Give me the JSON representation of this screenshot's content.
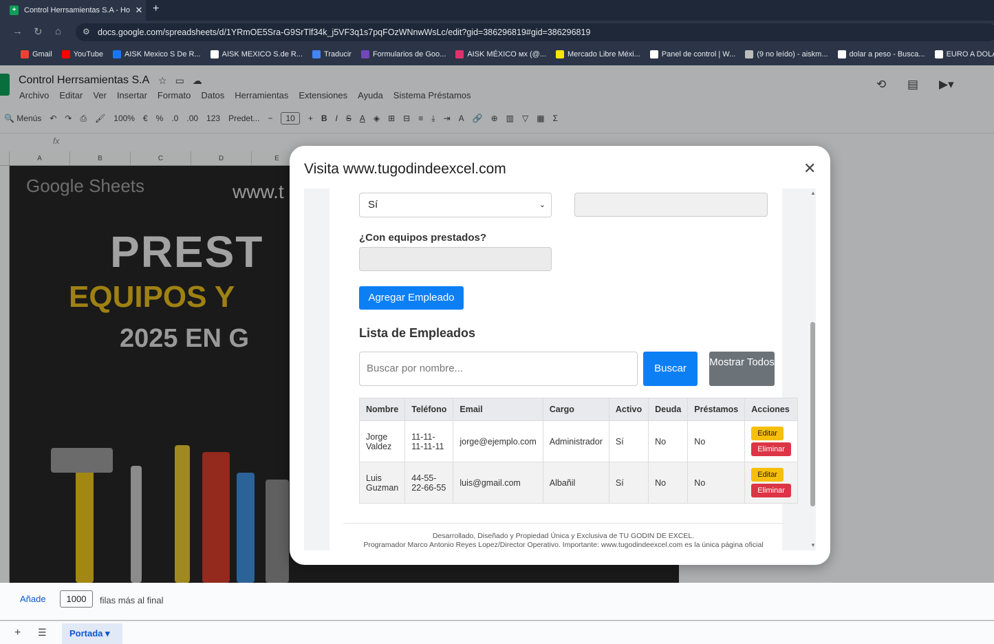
{
  "browser": {
    "tab_title": "Control Herrsamientas S.A - Ho",
    "tab_close": "✕",
    "new_tab": "+",
    "url": "docs.google.com/spreadsheets/d/1YRmOE5Sra-G9SrTlf34k_j5VF3q1s7pqFOzWNnwWsLc/edit?gid=386296819#gid=386296819",
    "bookmarks": [
      {
        "label": "Gmail",
        "color": "#ea4335"
      },
      {
        "label": "YouTube",
        "color": "#ff0000"
      },
      {
        "label": "AISK Mexico S De R...",
        "color": "#1877f2"
      },
      {
        "label": "AISK MEXICO S.de R...",
        "color": "#ffffff"
      },
      {
        "label": "Traducir",
        "color": "#4285f4"
      },
      {
        "label": "Formularios de Goo...",
        "color": "#7248b9"
      },
      {
        "label": "AISK MÉXICO ᴍx (@...",
        "color": "#e1306c"
      },
      {
        "label": "Mercado Libre Méxi...",
        "color": "#ffe600"
      },
      {
        "label": "Panel de control | W...",
        "color": "#ffffff"
      },
      {
        "label": "(9 no leído) - aiskm...",
        "color": "#bdbdbd"
      },
      {
        "label": "dolar a peso - Busca...",
        "color": "#ffffff"
      },
      {
        "label": "EURO A DOLAR - B...",
        "color": "#ffffff"
      }
    ]
  },
  "sheets": {
    "doc_title": "Control Herrsamientas S.A",
    "menu": [
      "Archivo",
      "Editar",
      "Ver",
      "Insertar",
      "Formato",
      "Datos",
      "Herramientas",
      "Extensiones",
      "Ayuda",
      "Sistema Préstamos"
    ],
    "toolbar": {
      "menus": "Menús",
      "zoom": "100%",
      "currency": "€",
      "percent": "%",
      "dec_less": ".0",
      "dec_more": ".00",
      "num_format": "123",
      "font": "Predet...",
      "font_size": "10",
      "bold": "B",
      "italic": "I",
      "strike": "S",
      "text_color": "A"
    },
    "fx": "fx",
    "columns": [
      "A",
      "B",
      "C",
      "D",
      "E"
    ],
    "banner": {
      "gs_text": "Google Sheets",
      "www_text": "www.t",
      "line1": "PREST",
      "line2": "EQUIPOS Y",
      "line3": "2025 EN G"
    },
    "add_rows": {
      "add_label": "Añade",
      "count": "1000",
      "suffix": "filas más al final"
    },
    "sheet_tab": "Portada"
  },
  "dialog": {
    "title": "Visita www.tugodindeexcel.com",
    "close": "✕",
    "select_value": "Sí",
    "label_equipos": "¿Con equipos prestados?",
    "add_button": "Agregar Empleado",
    "list_heading": "Lista de Empleados",
    "search_placeholder": "Buscar por nombre...",
    "search_button": "Buscar",
    "show_all_button": "Mostrar Todos",
    "table": {
      "headers": [
        "Nombre",
        "Teléfono",
        "Email",
        "Cargo",
        "Activo",
        "Deuda",
        "Préstamos",
        "Acciones"
      ],
      "rows": [
        {
          "nombre": "Jorge Valdez",
          "telefono": "11-11-11-11-11",
          "email": "jorge@ejemplo.com",
          "cargo": "Administrador",
          "activo": "Sí",
          "deuda": "No",
          "prestamos": "No"
        },
        {
          "nombre": "Luis Guzman",
          "telefono": "44-55-22-66-55",
          "email": "luis@gmail.com",
          "cargo": "Albañil",
          "activo": "Sí",
          "deuda": "No",
          "prestamos": "No"
        }
      ],
      "edit_label": "Editar",
      "delete_label": "Eliminar"
    },
    "footer_line1": "Desarrollado, Diseñado y Propiedad Única y Exclusiva de TU GODIN DE EXCEL.",
    "footer_line2": "Programador Marco Antonio Reyes Lopez/Director Operativo. Importante: www.tugodindeexcel.com es la única página oficial"
  }
}
